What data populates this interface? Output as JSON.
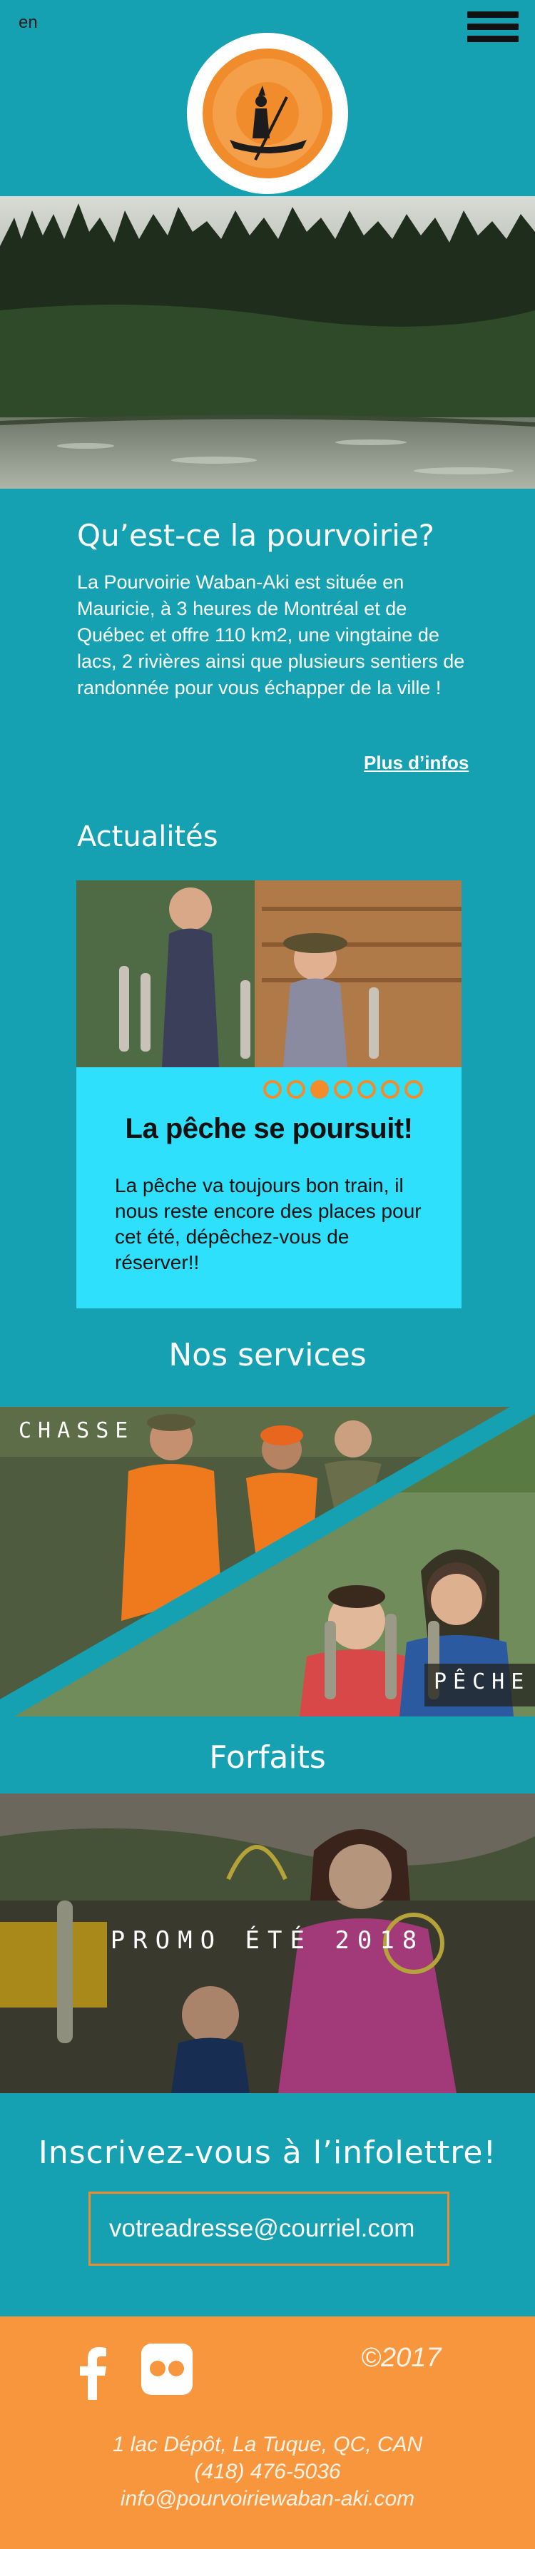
{
  "header": {
    "language": "en",
    "menu_icon": "hamburger-icon",
    "logo_icon": "canoe-logo-icon"
  },
  "about": {
    "title": "Qu’est-ce la pourvoirie?",
    "text": "La Pourvoirie Waban-Aki est située en Mauricie, à 3 heures de Montréal et de Québec et offre 110 km2, une vingtaine de lacs, 2 rivières ainsi que plusieurs sentiers de randonnée pour vous échapper de la ville !",
    "link": "Plus d’infos"
  },
  "news": {
    "title": "Actualités",
    "headline": "La pêche se poursuit!",
    "body": "La pêche va toujours bon train, il nous reste encore des places pour cet été, dépêchez-vous de réserver!!",
    "slide_count": 7,
    "active_slide": 3
  },
  "services": {
    "title": "Nos services",
    "hunting_label": "CHASSE",
    "fishing_label": "PÊCHE"
  },
  "forfaits": {
    "title": "Forfaits",
    "promo_label": "PROMO ÉTÉ 2018"
  },
  "newsletter": {
    "title": "Inscrivez-vous à l’infolettre!",
    "placeholder": "votreadresse@courriel.com"
  },
  "footer": {
    "facebook_icon": "facebook-icon",
    "flickr_icon": "flickr-icon",
    "copyright": "©2017",
    "address": "1 lac Dépôt, La Tuque, QC, CAN",
    "phone": "(418) 476-5036",
    "email": "info@pourvoiriewaban-aki.com"
  },
  "colors": {
    "teal": "#16a1b3",
    "cyan_card": "#2ee0fb",
    "orange": "#f08c2c",
    "footer_orange": "#f8963e"
  }
}
